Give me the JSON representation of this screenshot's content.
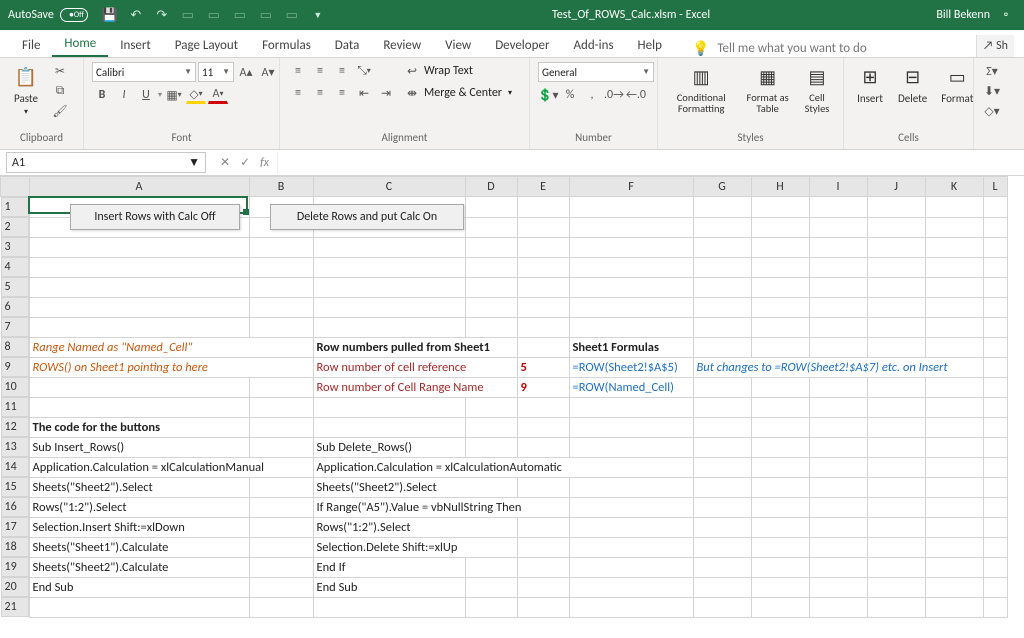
{
  "titlebar": {
    "autosave": "AutoSave",
    "autosave_state": "Off",
    "filename": "Test_Of_ROWS_Calc.xlsm  -  Excel",
    "user": "Bill Bekenn"
  },
  "tabs": {
    "file": "File",
    "home": "Home",
    "insert": "Insert",
    "pagelayout": "Page Layout",
    "formulas": "Formulas",
    "data": "Data",
    "review": "Review",
    "view": "View",
    "developer": "Developer",
    "addins": "Add-ins",
    "help": "Help",
    "tellme": "Tell me what you want to do",
    "share": "Sh"
  },
  "ribbon": {
    "clipboard": {
      "label": "Clipboard",
      "paste": "Paste"
    },
    "font": {
      "label": "Font",
      "name": "Calibri",
      "size": "11",
      "bold": "B",
      "italic": "I",
      "underline": "U"
    },
    "alignment": {
      "label": "Alignment",
      "wrap": "Wrap Text",
      "merge": "Merge & Center"
    },
    "number": {
      "label": "Number",
      "format": "General"
    },
    "styles": {
      "label": "Styles",
      "cond": "Conditional Formatting",
      "table": "Format as Table",
      "cell": "Cell Styles"
    },
    "cells": {
      "label": "Cells",
      "insert": "Insert",
      "delete": "Delete",
      "format": "Format"
    }
  },
  "fbar": {
    "name": "A1",
    "fx": "fx"
  },
  "columns": [
    "A",
    "B",
    "C",
    "D",
    "E",
    "F",
    "G",
    "H",
    "I",
    "J",
    "K",
    "L"
  ],
  "rows": [
    "1",
    "2",
    "3",
    "4",
    "5",
    "6",
    "7",
    "8",
    "9",
    "10",
    "11",
    "12",
    "13",
    "14",
    "15",
    "16",
    "17",
    "18",
    "19",
    "20",
    "21"
  ],
  "buttons": {
    "insert": "Insert Rows with Calc Off",
    "delete": "Delete Rows and put Calc On"
  },
  "cells": {
    "A8": "Range Named as \"Named_Cell\"",
    "C8": "Row numbers pulled from Sheet1",
    "F8": "Sheet1 Formulas",
    "A9": "ROWS() on Sheet1 pointing to here",
    "C9": "Row number of cell reference",
    "E9": "5",
    "F9": "=ROW(Sheet2!$A$5)",
    "G9": "But changes to =ROW(Sheet2!$A$7) etc. on Insert",
    "C10": "Row number of Cell Range Name",
    "E10": "9",
    "F10": "=ROW(Named_Cell)",
    "A12": "The code for the buttons",
    "A13": "Sub Insert_Rows()",
    "C13": "Sub Delete_Rows()",
    "A14": "    Application.Calculation = xlCalculationManual",
    "C14": "    Application.Calculation = xlCalculationAutomatic",
    "A15": "    Sheets(\"Sheet2\").Select",
    "C15": "    Sheets(\"Sheet2\").Select",
    "A16": "    Rows(\"1:2\").Select",
    "C16": "    If Range(\"A5\").Value = vbNullString Then",
    "A17": "    Selection.Insert Shift:=xlDown",
    "C17": "        Rows(\"1:2\").Select",
    "A18": "    Sheets(\"Sheet1\").Calculate",
    "C18": "        Selection.Delete Shift:=xlUp",
    "A19": "    Sheets(\"Sheet2\").Calculate",
    "C19": "    End If",
    "A20": "End Sub",
    "C20": "End Sub"
  }
}
